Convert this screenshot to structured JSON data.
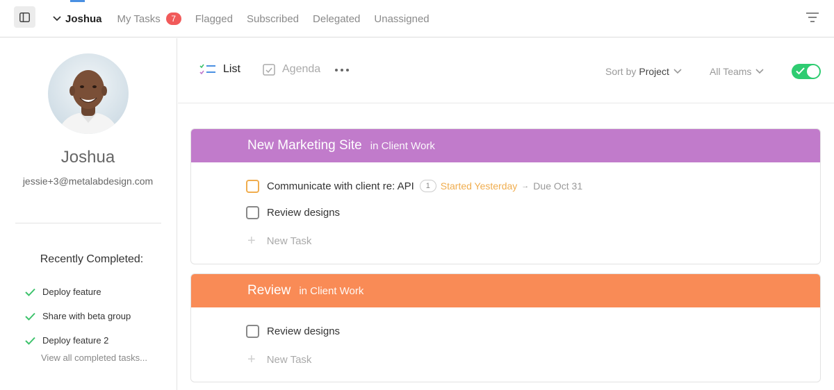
{
  "topbar": {
    "user": "Joshua",
    "nav": [
      {
        "label": "My Tasks",
        "badge": "7"
      },
      {
        "label": "Flagged"
      },
      {
        "label": "Subscribed"
      },
      {
        "label": "Delegated"
      },
      {
        "label": "Unassigned"
      }
    ],
    "icons": {
      "sidebar_toggle": "sidebar-toggle-icon",
      "filter": "filter-icon",
      "user_dropdown": "chevron-down-icon"
    },
    "colors": {
      "badge": "#f15a5a",
      "accent": "#4a90e2"
    }
  },
  "sidebar": {
    "profile": {
      "name": "Joshua",
      "email": "jessie+3@metalabdesign.com"
    },
    "recent_heading": "Recently Completed:",
    "recent_items": [
      {
        "label": "Deploy feature"
      },
      {
        "label": "Share with beta group"
      },
      {
        "label": "Deploy feature 2"
      }
    ],
    "view_all": "View all completed tasks..."
  },
  "main": {
    "views": {
      "list": "List",
      "agenda": "Agenda",
      "active": "List"
    },
    "sort": {
      "prefix": "Sort by",
      "value": "Project"
    },
    "teams": "All Teams",
    "toggle_on": true,
    "projects": [
      {
        "title": "New Marketing Site",
        "context": "in Client Work",
        "color": "#c17bcb",
        "tasks": [
          {
            "label": "Communicate with client re: API",
            "comments": "1",
            "started": "Started Yesterday",
            "due": "Due Oct 31",
            "status": "in-progress"
          },
          {
            "label": "Review designs",
            "status": "open"
          }
        ],
        "new_task": "New Task"
      },
      {
        "title": "Review",
        "context": "in Client Work",
        "color": "#f98b56",
        "tasks": [
          {
            "label": "Review designs",
            "status": "open"
          }
        ],
        "new_task": "New Task"
      }
    ]
  }
}
